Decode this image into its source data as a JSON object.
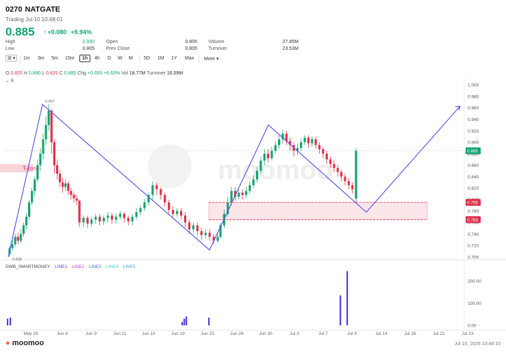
{
  "header": {
    "code": "0270",
    "name": "NATGATE",
    "trading_time": "Trading Jul 10 10:48:01",
    "price": "0.885",
    "arrow": "↑",
    "change": "+0.080",
    "change_pct": "+9.94%"
  },
  "stats": [
    {
      "label": "High",
      "value": "0.890",
      "color": "green"
    },
    {
      "label": "Open",
      "value": "0.805",
      "color": "normal"
    },
    {
      "label": "Volume",
      "value": "27.85M",
      "color": "normal"
    },
    {
      "label": "Low",
      "value": "0.805",
      "color": "normal"
    },
    {
      "label": "Prev Close",
      "value": "0.805",
      "color": "normal"
    },
    {
      "label": "Turnover",
      "value": "23.53M",
      "color": "normal"
    }
  ],
  "toolbar": {
    "layout_label": "⊞",
    "timeframes": [
      "1m",
      "3m",
      "5m",
      "15m",
      "1h",
      "4h",
      "D",
      "W",
      "M",
      "5D",
      "1M",
      "1Y",
      "Max"
    ],
    "selected": "1h",
    "more_label": "More"
  },
  "ohlc_bar": {
    "o_label": "O",
    "o_value": "0.825",
    "h_label": "H",
    "h_value": "0.890",
    "l_label": "L",
    "l_value": "0.825",
    "c_label": "C",
    "c_value": "0.885",
    "chg_label": "Chg",
    "chg_value": "+0.055",
    "chg_pct": "+6.63%",
    "vol_label": "Vol",
    "vol_value": "18.77M",
    "turnover_label": "Turnover",
    "turnover_value": "16.09M",
    "collapse_label": "8"
  },
  "indicator": {
    "name": "DWB_SMARTMONEY",
    "lines": [
      {
        "label": "LINE1",
        "color": "#4b3fd8"
      },
      {
        "label": "LINE2",
        "color": "#d13fd0"
      },
      {
        "label": "LINE3",
        "color": "#3f6fd8"
      },
      {
        "label": "LINE4",
        "color": "#3fcfd8"
      },
      {
        "label": "LINE5",
        "color": "#3fa0d8"
      }
    ]
  },
  "watermark": "moomoo",
  "footer": {
    "brand": "moomoo",
    "datetime": "Jul 10, 2026 10:48:10"
  },
  "chart_data": {
    "type": "candlestick",
    "price_axis": {
      "ticks": [
        0.7,
        0.72,
        0.74,
        0.76,
        0.78,
        0.8,
        0.82,
        0.84,
        0.86,
        0.88,
        0.9,
        0.92,
        0.94,
        0.96,
        0.98,
        1.0
      ],
      "ylim": [
        0.695,
        1.005
      ]
    },
    "x_labels": [
      "May 29",
      "Jun 4",
      "Jun 9",
      "Jun 11",
      "Jun 15",
      "Jun 19",
      "Jun 23",
      "Jun 26",
      "Jun 30",
      "Jul 3",
      "Jul 7",
      "Jul 9",
      "Jul 14",
      "Jul 16",
      "Jul 21",
      "Jul 23"
    ],
    "current_price_tag": "0.885",
    "zone_labels": {
      "upper": "0.795",
      "lower": "0.765",
      "left_zone": "T-zone"
    },
    "point_labels": {
      "high": "0.957",
      "low": "0.698"
    },
    "colors": {
      "up": "#13a36e",
      "down": "#e0304a",
      "pattern": "#5b56e8",
      "zone": "#f7c9d0"
    },
    "zigzag": [
      {
        "x": "start",
        "y": 0.7
      },
      {
        "x": "May 29",
        "y": 0.966
      },
      {
        "x": "Jun 22",
        "y": 0.712
      },
      {
        "x": "Jun 30",
        "y": 0.93
      },
      {
        "x": "Jul 9",
        "y": 0.778
      },
      {
        "x": "Jul 23",
        "y": 0.963
      }
    ],
    "candles": [
      [
        0.705,
        0.715,
        0.7,
        0.718
      ],
      [
        0.715,
        0.722,
        0.71,
        0.73
      ],
      [
        0.722,
        0.735,
        0.718,
        0.74
      ],
      [
        0.735,
        0.728,
        0.722,
        0.742
      ],
      [
        0.728,
        0.74,
        0.725,
        0.748
      ],
      [
        0.74,
        0.755,
        0.735,
        0.76
      ],
      [
        0.755,
        0.77,
        0.748,
        0.775
      ],
      [
        0.77,
        0.795,
        0.765,
        0.8
      ],
      [
        0.795,
        0.815,
        0.79,
        0.82
      ],
      [
        0.815,
        0.835,
        0.805,
        0.84
      ],
      [
        0.835,
        0.86,
        0.83,
        0.87
      ],
      [
        0.86,
        0.88,
        0.85,
        0.89
      ],
      [
        0.88,
        0.905,
        0.87,
        0.915
      ],
      [
        0.905,
        0.93,
        0.895,
        0.945
      ],
      [
        0.93,
        0.955,
        0.92,
        0.966
      ],
      [
        0.955,
        0.9,
        0.88,
        0.958
      ],
      [
        0.9,
        0.86,
        0.845,
        0.905
      ],
      [
        0.86,
        0.845,
        0.835,
        0.87
      ],
      [
        0.845,
        0.83,
        0.822,
        0.852
      ],
      [
        0.83,
        0.822,
        0.812,
        0.838
      ],
      [
        0.822,
        0.828,
        0.815,
        0.835
      ],
      [
        0.828,
        0.815,
        0.808,
        0.832
      ],
      [
        0.815,
        0.808,
        0.8,
        0.82
      ],
      [
        0.808,
        0.802,
        0.795,
        0.812
      ],
      [
        0.802,
        0.798,
        0.79,
        0.808
      ],
      [
        0.798,
        0.76,
        0.752,
        0.8
      ],
      [
        0.76,
        0.768,
        0.752,
        0.772
      ],
      [
        0.768,
        0.758,
        0.75,
        0.772
      ],
      [
        0.758,
        0.765,
        0.752,
        0.77
      ],
      [
        0.765,
        0.77,
        0.758,
        0.775
      ],
      [
        0.77,
        0.762,
        0.755,
        0.775
      ],
      [
        0.762,
        0.768,
        0.756,
        0.772
      ],
      [
        0.768,
        0.772,
        0.76,
        0.778
      ],
      [
        0.772,
        0.765,
        0.758,
        0.776
      ],
      [
        0.765,
        0.77,
        0.758,
        0.775
      ],
      [
        0.77,
        0.775,
        0.765,
        0.78
      ],
      [
        0.775,
        0.768,
        0.76,
        0.778
      ],
      [
        0.768,
        0.762,
        0.755,
        0.772
      ],
      [
        0.762,
        0.77,
        0.755,
        0.775
      ],
      [
        0.77,
        0.778,
        0.765,
        0.785
      ],
      [
        0.778,
        0.785,
        0.772,
        0.79
      ],
      [
        0.785,
        0.795,
        0.78,
        0.802
      ],
      [
        0.795,
        0.808,
        0.79,
        0.812
      ],
      [
        0.808,
        0.825,
        0.8,
        0.832
      ],
      [
        0.825,
        0.818,
        0.808,
        0.83
      ],
      [
        0.818,
        0.808,
        0.8,
        0.822
      ],
      [
        0.808,
        0.795,
        0.788,
        0.812
      ],
      [
        0.795,
        0.782,
        0.775,
        0.8
      ],
      [
        0.782,
        0.775,
        0.768,
        0.788
      ],
      [
        0.775,
        0.78,
        0.77,
        0.785
      ],
      [
        0.78,
        0.772,
        0.765,
        0.785
      ],
      [
        0.772,
        0.76,
        0.752,
        0.778
      ],
      [
        0.76,
        0.748,
        0.74,
        0.765
      ],
      [
        0.748,
        0.755,
        0.742,
        0.76
      ],
      [
        0.755,
        0.745,
        0.738,
        0.76
      ],
      [
        0.745,
        0.738,
        0.73,
        0.75
      ],
      [
        0.738,
        0.742,
        0.732,
        0.748
      ],
      [
        0.742,
        0.735,
        0.728,
        0.748
      ],
      [
        0.735,
        0.728,
        0.722,
        0.74
      ],
      [
        0.728,
        0.735,
        0.725,
        0.742
      ],
      [
        0.735,
        0.755,
        0.732,
        0.76
      ],
      [
        0.755,
        0.775,
        0.75,
        0.782
      ],
      [
        0.775,
        0.795,
        0.77,
        0.805
      ],
      [
        0.795,
        0.815,
        0.79,
        0.822
      ],
      [
        0.815,
        0.805,
        0.798,
        0.822
      ],
      [
        0.805,
        0.812,
        0.8,
        0.818
      ],
      [
        0.812,
        0.808,
        0.8,
        0.818
      ],
      [
        0.808,
        0.815,
        0.802,
        0.822
      ],
      [
        0.815,
        0.825,
        0.81,
        0.832
      ],
      [
        0.825,
        0.835,
        0.82,
        0.842
      ],
      [
        0.835,
        0.85,
        0.83,
        0.858
      ],
      [
        0.85,
        0.868,
        0.845,
        0.875
      ],
      [
        0.868,
        0.88,
        0.86,
        0.888
      ],
      [
        0.88,
        0.872,
        0.865,
        0.888
      ],
      [
        0.872,
        0.885,
        0.868,
        0.892
      ],
      [
        0.885,
        0.895,
        0.88,
        0.902
      ],
      [
        0.895,
        0.905,
        0.888,
        0.912
      ],
      [
        0.905,
        0.915,
        0.898,
        0.922
      ],
      [
        0.915,
        0.902,
        0.895,
        0.92
      ],
      [
        0.902,
        0.895,
        0.885,
        0.908
      ],
      [
        0.895,
        0.885,
        0.875,
        0.9
      ],
      [
        0.885,
        0.89,
        0.878,
        0.898
      ],
      [
        0.89,
        0.9,
        0.885,
        0.906
      ],
      [
        0.9,
        0.908,
        0.895,
        0.912
      ],
      [
        0.908,
        0.898,
        0.89,
        0.912
      ],
      [
        0.898,
        0.905,
        0.892,
        0.91
      ],
      [
        0.905,
        0.895,
        0.888,
        0.91
      ],
      [
        0.895,
        0.888,
        0.88,
        0.9
      ],
      [
        0.888,
        0.88,
        0.872,
        0.892
      ],
      [
        0.88,
        0.87,
        0.862,
        0.885
      ],
      [
        0.87,
        0.862,
        0.855,
        0.875
      ],
      [
        0.862,
        0.855,
        0.848,
        0.868
      ],
      [
        0.855,
        0.848,
        0.84,
        0.86
      ],
      [
        0.848,
        0.84,
        0.832,
        0.852
      ],
      [
        0.84,
        0.832,
        0.825,
        0.845
      ],
      [
        0.832,
        0.825,
        0.818,
        0.838
      ],
      [
        0.825,
        0.818,
        0.81,
        0.83
      ],
      [
        0.818,
        0.81,
        0.802,
        0.822
      ],
      [
        0.81,
        0.802,
        0.795,
        0.815
      ],
      [
        0.802,
        0.81,
        0.798,
        0.815
      ],
      [
        0.81,
        0.82,
        0.805,
        0.825
      ],
      [
        0.82,
        0.885,
        0.815,
        0.89
      ]
    ],
    "indicator_axis": {
      "ticks": [
        0,
        100,
        200
      ],
      "labels": [
        "0.00",
        "100.00",
        "200.00"
      ]
    },
    "smartmoney_bars": [
      {
        "x": "start",
        "value": 30
      },
      {
        "x": "start",
        "value": 35
      },
      {
        "x": "Jun 19",
        "value": 15
      },
      {
        "x": "Jun 19",
        "value": 30
      },
      {
        "x": "Jun 19",
        "value": 40
      },
      {
        "x": "Jun 23",
        "value": 35
      },
      {
        "x": "Jul 8",
        "value": 135
      },
      {
        "x": "Jul 9",
        "value": 245
      }
    ]
  }
}
